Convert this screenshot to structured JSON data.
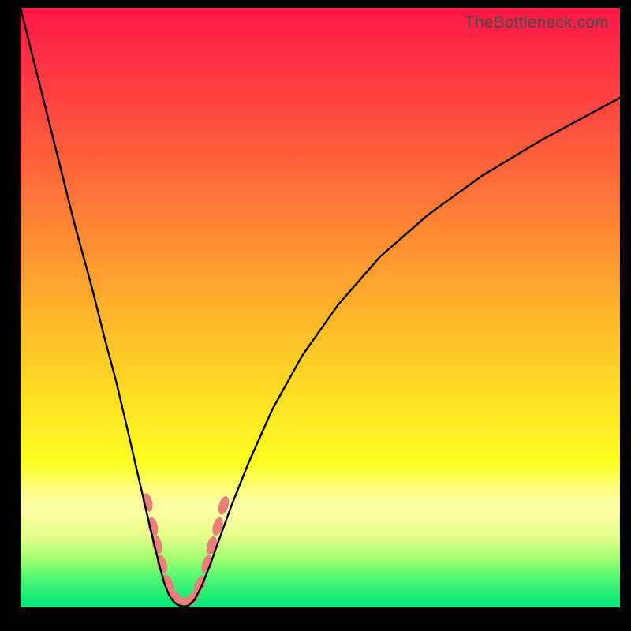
{
  "watermark": "TheBottleneck.com",
  "colors": {
    "curve": "#000000",
    "marker_fill": "#e88079",
    "marker_stroke": "#c05650",
    "frame": "#000000"
  },
  "chart_data": {
    "type": "line",
    "title": "",
    "xlabel": "",
    "ylabel": "",
    "xlim": [
      0,
      100
    ],
    "ylim": [
      0,
      100
    ],
    "series": [
      {
        "name": "left-branch",
        "x": [
          0,
          3,
          6,
          9,
          12,
          14,
          16,
          18,
          19.5,
          21,
          22.3,
          23.3,
          24,
          24.8,
          25.5,
          26.1,
          26.6,
          27,
          27.4
        ],
        "y": [
          100,
          88,
          76,
          64,
          53,
          45,
          37.5,
          29,
          22.5,
          16,
          10.5,
          6.5,
          4,
          2,
          1,
          0.5,
          0.3,
          0.2,
          0.15
        ]
      },
      {
        "name": "right-branch",
        "x": [
          27.4,
          28,
          29,
          30.2,
          31.6,
          33.2,
          35.2,
          38,
          42,
          47,
          53,
          60,
          68,
          77,
          87,
          100
        ],
        "y": [
          0.15,
          0.3,
          1.2,
          3.5,
          7,
          11.5,
          17,
          24,
          33,
          42,
          50.5,
          58.5,
          65.5,
          72,
          78,
          85
        ]
      }
    ],
    "markers": {
      "name": "highlight-beads",
      "points": [
        {
          "x": 21.2,
          "y": 17.5
        },
        {
          "x": 22.1,
          "y": 13.5
        },
        {
          "x": 22.8,
          "y": 10.5
        },
        {
          "x": 23.6,
          "y": 7.2
        },
        {
          "x": 24.6,
          "y": 4.0
        },
        {
          "x": 25.9,
          "y": 1.6
        },
        {
          "x": 27.2,
          "y": 0.9
        },
        {
          "x": 28.6,
          "y": 1.4
        },
        {
          "x": 29.9,
          "y": 3.8
        },
        {
          "x": 31.1,
          "y": 7.2
        },
        {
          "x": 31.9,
          "y": 10.3
        },
        {
          "x": 32.9,
          "y": 13.5
        },
        {
          "x": 33.9,
          "y": 17.0
        }
      ],
      "rx": 6,
      "ry": 12
    }
  }
}
